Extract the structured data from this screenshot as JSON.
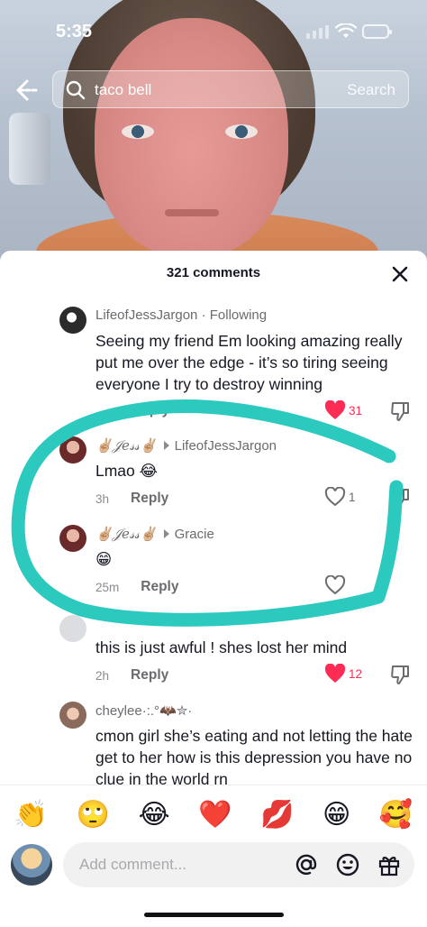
{
  "status_bar": {
    "time": "5:35"
  },
  "search": {
    "query": "taco bell",
    "button_label": "Search"
  },
  "sheet": {
    "title": "321 comments"
  },
  "comments": [
    {
      "username": "LifeofJessJargon",
      "following": "· Following",
      "text": "Seeing my friend Em looking amazing really put me over the edge - it’s so tiring seeing everyone I try to destroy winning",
      "reply_label": "Reply",
      "likes": "31"
    },
    {
      "username": "✌🏼𝒥𝑒𝓈𝓈✌🏼",
      "reply_to": "LifeofJessJargon",
      "text": "Lmao 😂",
      "time": "3h",
      "reply_label": "Reply",
      "likes": "1"
    },
    {
      "username": "✌🏼𝒥𝑒𝓈𝓈✌🏼",
      "reply_to": "Gracie",
      "text": "😁",
      "time": "25m",
      "reply_label": "Reply",
      "likes": ""
    },
    {
      "username": "",
      "text": "this is just awful ! shes lost her mind",
      "time": "2h",
      "reply_label": "Reply",
      "likes": "12"
    },
    {
      "username": "cheylee·:.°🦇✮·",
      "text": "cmon girl she’s eating and not letting the hate get to her how is this depression you have no clue in the world rn"
    }
  ],
  "emoji_bar": [
    "👏",
    "🙄",
    "😂",
    "❤️",
    "💋",
    "😁",
    "🥰"
  ],
  "composer": {
    "placeholder": "Add comment..."
  },
  "colors": {
    "accent_red": "#fe2c55",
    "annotation_teal": "#2cc9bf"
  }
}
